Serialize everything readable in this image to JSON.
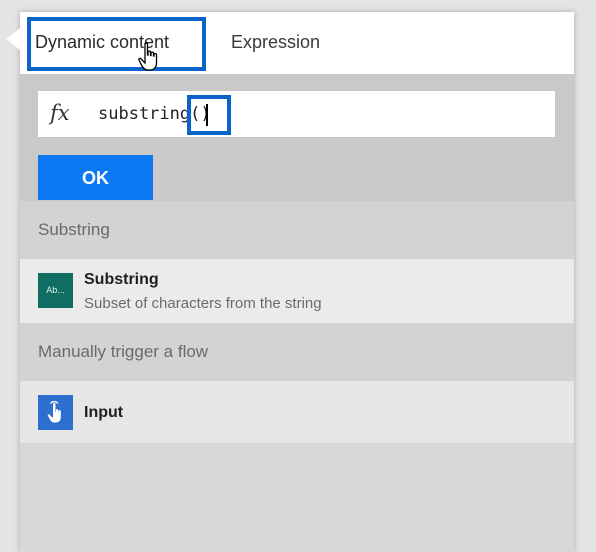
{
  "tabs": {
    "dynamic_label": "Dynamic content",
    "expression_label": "Expression"
  },
  "expression": {
    "fx_symbol": "fx",
    "text": "substring()"
  },
  "buttons": {
    "ok_label": "OK"
  },
  "sections": [
    {
      "header": "Substring",
      "items": [
        {
          "icon_text": "Ab...",
          "title": "Substring",
          "description": "Subset of characters from the string"
        }
      ]
    },
    {
      "header": "Manually trigger a flow",
      "items": [
        {
          "icon": "touch-icon",
          "title": "Input"
        }
      ]
    }
  ],
  "colors": {
    "accent": "#0c78f2",
    "highlight_border": "#0a63c8",
    "substring_icon_bg": "#0f6d62",
    "input_icon_bg": "#2d6fcf"
  }
}
